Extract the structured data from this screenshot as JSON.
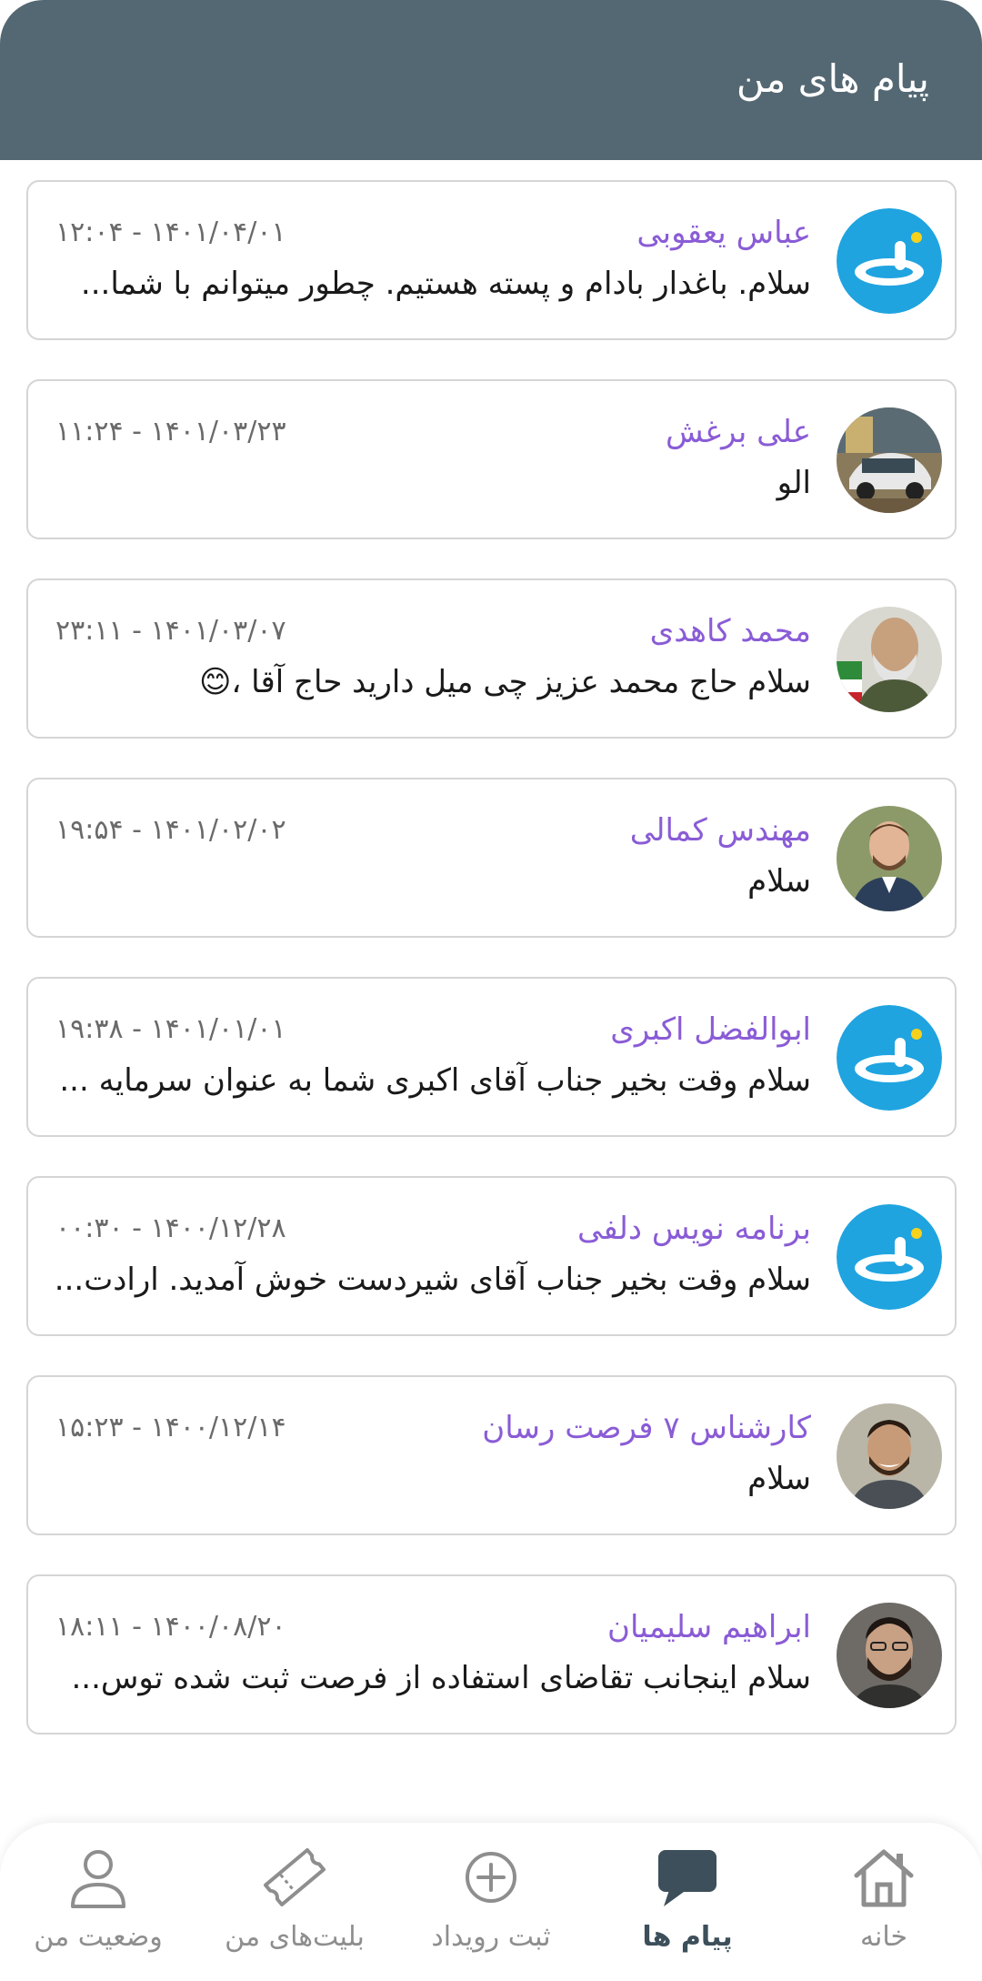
{
  "header": {
    "title": "پیام های من"
  },
  "messages": [
    {
      "name": "عباس یعقوبی",
      "time": "۱۴۰۱/۰۴/۰۱ - ۱۲:۰۴",
      "preview": "سلام. باغدار بادام و پسته هستیم. چطور میتوانم با شما..."
    },
    {
      "name": "علی برغش",
      "time": "۱۴۰۱/۰۳/۲۳ - ۱۱:۲۴",
      "preview": "الو"
    },
    {
      "name": "محمد کاهدی",
      "time": "۱۴۰۱/۰۳/۰۷ - ۲۳:۱۱",
      "preview": "سلام حاج محمد عزیز چی میل دارید حاج آقا ،😊"
    },
    {
      "name": "مهندس کمالی",
      "time": "۱۴۰۱/۰۲/۰۲ - ۱۹:۵۴",
      "preview": "سلام"
    },
    {
      "name": "ابوالفضل اکبری",
      "time": "۱۴۰۱/۰۱/۰۱ - ۱۹:۳۸",
      "preview": "سلام وقت بخیر جناب آقای اکبری شما به عنوان سرمایه ..."
    },
    {
      "name": "برنامه نویس دلفی",
      "time": "۱۴۰۰/۱۲/۲۸ - ۰۰:۳۰",
      "preview": "سلام وقت بخیر جناب آقای شیردست خوش آمدید. ارادت..."
    },
    {
      "name": "کارشناس ۷ فرصت رسان",
      "time": "۱۴۰۰/۱۲/۱۴ - ۱۵:۲۳",
      "preview": "سلام"
    },
    {
      "name": "ابراهیم سلیمیان",
      "time": "۱۴۰۰/۰۸/۲۰ - ۱۸:۱۱",
      "preview": "سلام اینجانب تقاضای استفاده از فرصت ثبت شده توس..."
    }
  ],
  "nav": {
    "home": "خانه",
    "messages": "پیام ها",
    "add_event": "ثبت رویداد",
    "my_tickets": "بلیت‌های من",
    "my_status": "وضعیت من"
  },
  "colors": {
    "header": "#546873",
    "name": "#8a5cd6",
    "brand_blue": "#1fa4e0"
  }
}
